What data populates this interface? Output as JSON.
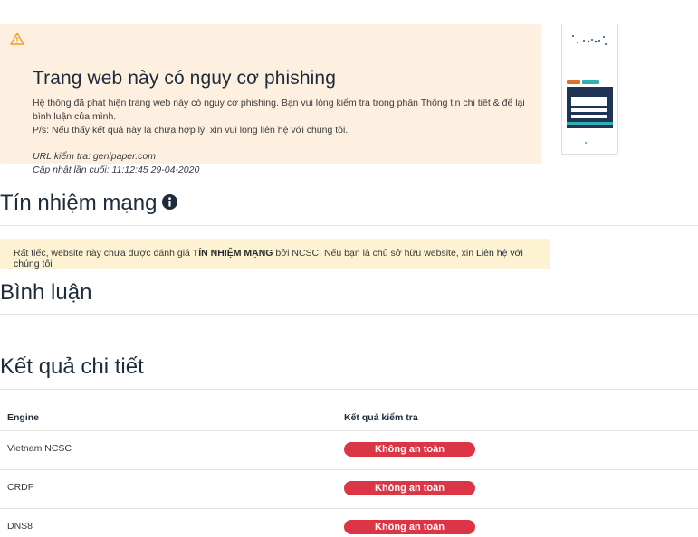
{
  "alert": {
    "icon": "warning-icon",
    "title": "Trang web này có nguy cơ phishing",
    "description_line1": "Hệ thống đã phát hiện trang web này có nguy cơ phishing. Bạn vui lòng kiểm tra trong phần Thông tin chi tiết & để lại bình luận của mình.",
    "description_line2": "P/s: Nếu thấy kết quả này là chưa hợp lý, xin vui lòng liên hệ với chúng tôi.",
    "url_line": "URL kiểm tra: genipaper.com",
    "updated_line": "Cập nhật lần cuối: 11:12:45 29-04-2020"
  },
  "reputation": {
    "title": "Tín nhiệm mạng",
    "icon": "info-icon",
    "notice_prefix": "Rất tiếc, website này chưa được đánh giá ",
    "notice_bold": "TÍN NHIỆM MẠNG",
    "notice_middle": " bởi NCSC. Nếu bạn là chủ sở hữu website, xin ",
    "notice_link": "Liên hệ với chúng tôi"
  },
  "comments": {
    "title": "Bình luận"
  },
  "details": {
    "title": "Kết quả chi tiết",
    "columns": [
      "Engine",
      "Kết quả kiểm tra"
    ],
    "rows": [
      {
        "engine": "Vietnam NCSC",
        "result": "Không an toàn"
      },
      {
        "engine": "CRDF",
        "result": "Không an toàn"
      },
      {
        "engine": "DNS8",
        "result": "Không an toàn"
      }
    ]
  },
  "colors": {
    "alert_bg": "#fdf0e0",
    "notice_bg": "#fdf3d2",
    "danger": "#dc3545",
    "heading": "#1d2b3a",
    "warning": "#f0a020"
  }
}
